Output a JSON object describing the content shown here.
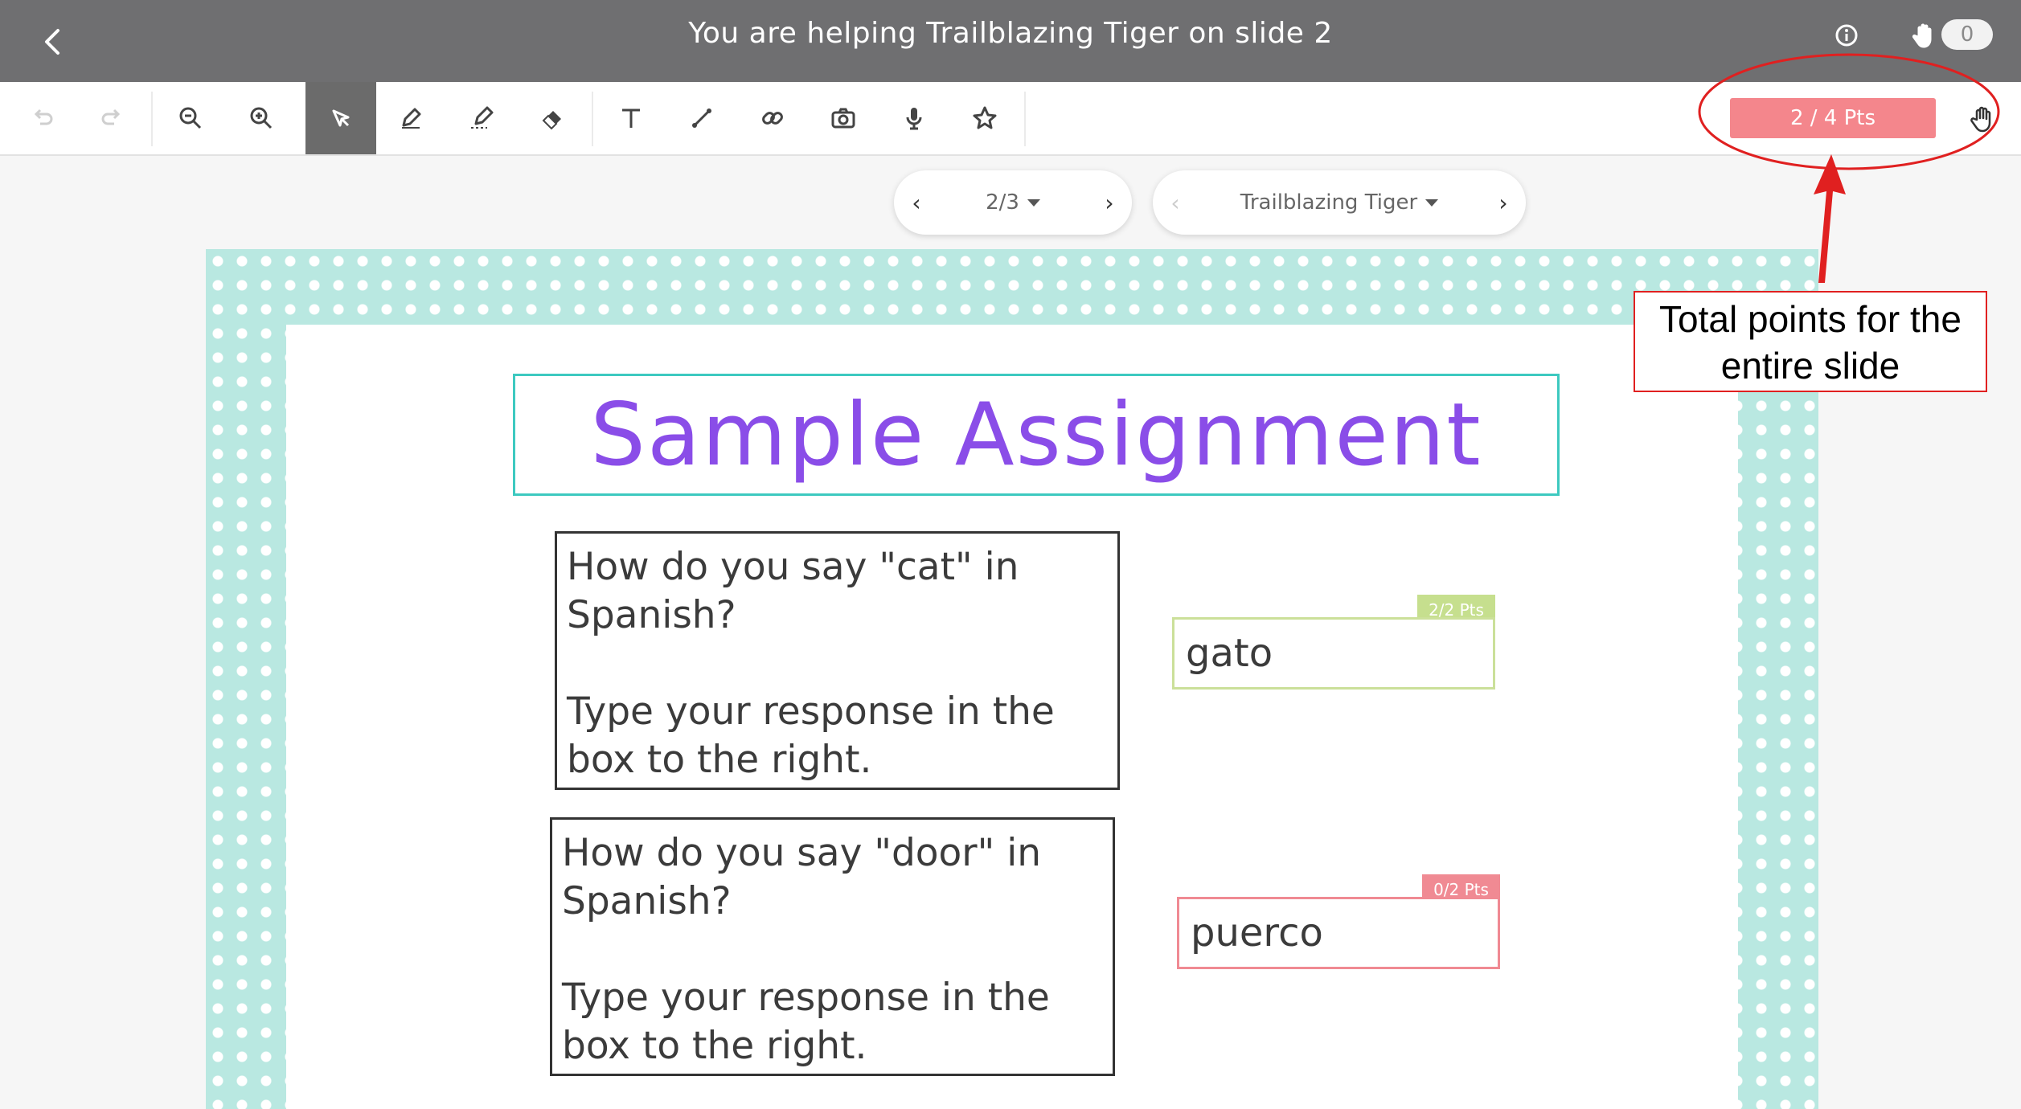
{
  "header": {
    "title": "You are helping Trailblazing Tiger on slide 2",
    "hand_raise_count": "0",
    "icons": [
      "back-chevron-icon",
      "info-icon",
      "hand-icon"
    ]
  },
  "toolbar": {
    "tools": [
      "undo-icon",
      "redo-icon",
      "zoom-out-icon",
      "zoom-in-icon",
      "select-pointer-icon",
      "pen-icon",
      "highlighter-icon",
      "eraser-icon",
      "text-icon",
      "line-icon",
      "link-icon",
      "camera-icon",
      "microphone-icon",
      "star-icon"
    ],
    "active_tool": "select-pointer-icon",
    "total_points": "2 / 4 Pts"
  },
  "nav": {
    "slide_position": "2/3",
    "student_name": "Trailblazing Tiger"
  },
  "slide": {
    "title": "Sample Assignment",
    "questions": [
      {
        "prompt": "How do you say \"cat\" in Spanish?",
        "instruction": "Type your response in the box to the right.",
        "answer": "gato",
        "points": "2/2 Pts"
      },
      {
        "prompt": "How do you say \"door\" in Spanish?",
        "instruction": "Type your response in the box to the right.",
        "answer": "puerco",
        "points": "0/2 Pts"
      }
    ]
  },
  "annotation": {
    "callout_text": "Total points for the entire slide"
  },
  "colors": {
    "header_bg": "#6f6f71",
    "accent_title": "#8a4de8",
    "title_border": "#3dc9c0",
    "correct": "#c6df8e",
    "incorrect": "#f08a93",
    "slide_pattern": "#b9e8e1",
    "annotation_red": "#e02020"
  }
}
